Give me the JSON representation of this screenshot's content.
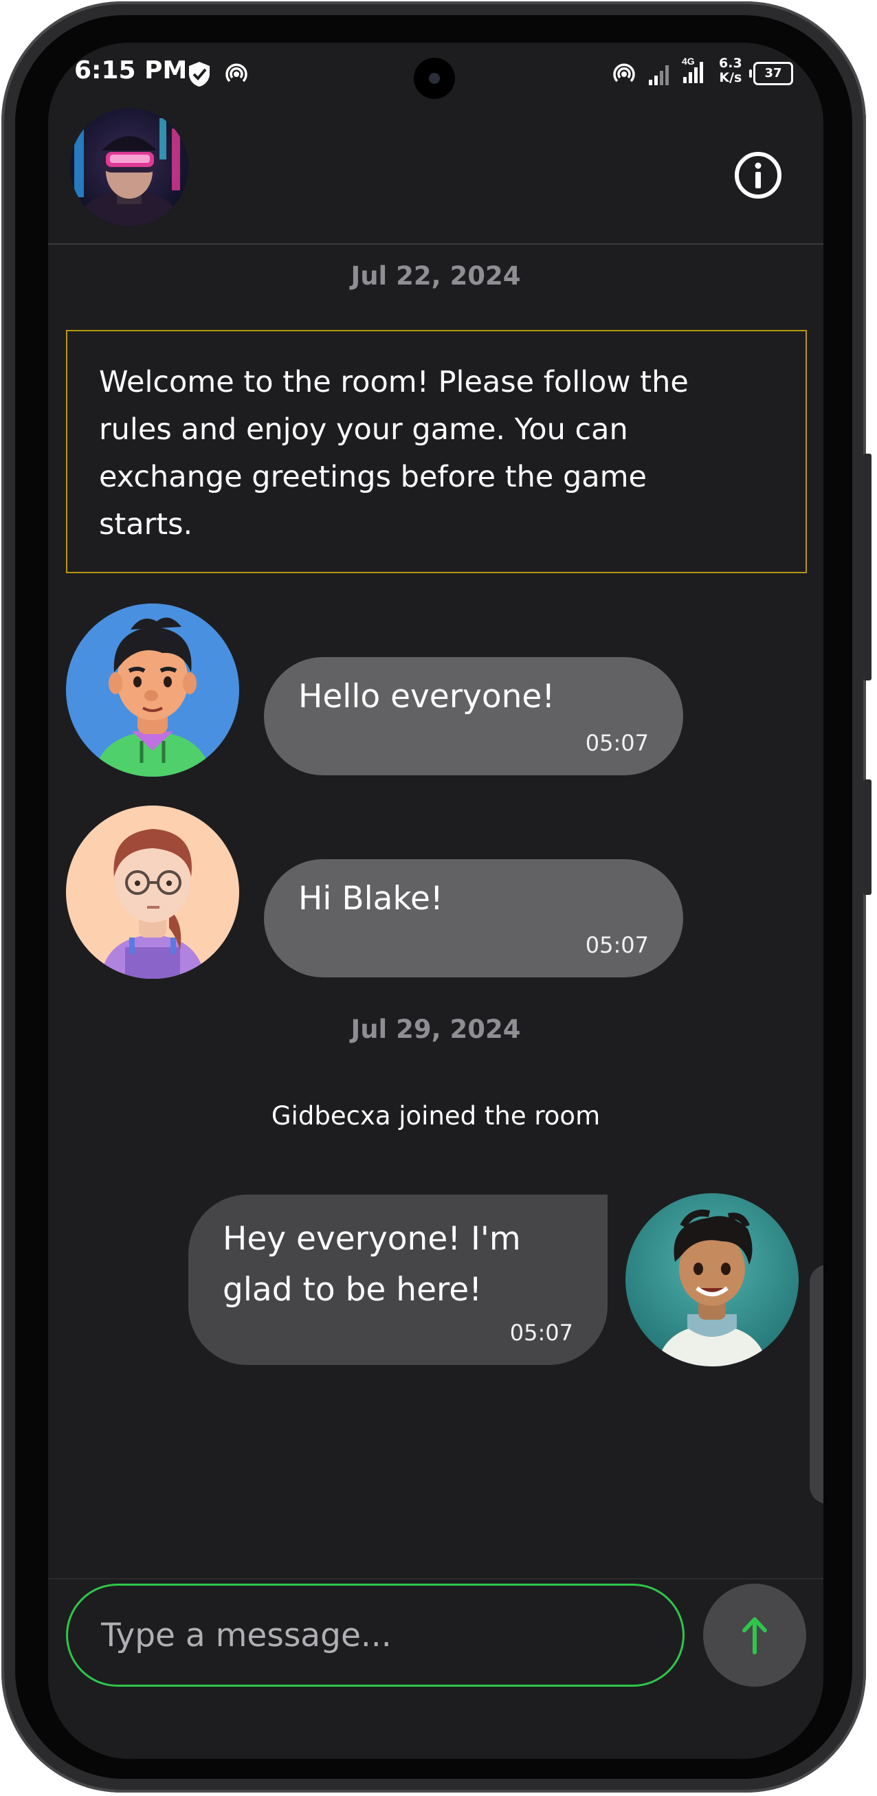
{
  "status_bar": {
    "time": "6:15 PM",
    "net_speed_top": "6.3",
    "net_speed_bottom": "K/s",
    "battery": "37",
    "network_type": "4G",
    "icons": [
      "shield-check-icon",
      "hotspot-icon",
      "hotspot-icon",
      "signal-icon",
      "signal-4g-icon",
      "battery-icon"
    ]
  },
  "header": {
    "avatar": "room-avatar-cyberpunk",
    "info_icon": "info-icon"
  },
  "chat": {
    "date_1": "Jul 22, 2024",
    "welcome_lines": [
      "Welcome to the room! Please follow the",
      "rules and enjoy your game. You can",
      "exchange greetings before the game",
      "starts."
    ],
    "messages": [
      {
        "text": "Hello everyone!",
        "time": "05:07",
        "avatar": "boy-avatar-blue"
      },
      {
        "text": "Hi Blake!",
        "time": "05:07",
        "avatar": "girl-avatar-peach"
      }
    ],
    "date_2": "Jul 29, 2024",
    "system_message": "Gidbecxa joined the room",
    "own_message": {
      "lines": [
        "Hey everyone! I'm",
        "glad to be here!"
      ],
      "time": "05:07",
      "avatar": "boy-avatar-teal"
    }
  },
  "composer": {
    "placeholder": "Type a message...",
    "send_icon": "arrow-up-icon"
  },
  "colors": {
    "background": "#1d1d1f",
    "bubble": "#626264",
    "own_bubble": "#464648",
    "accent_green": "#2fc64b",
    "welcome_border": "#b8960f"
  }
}
